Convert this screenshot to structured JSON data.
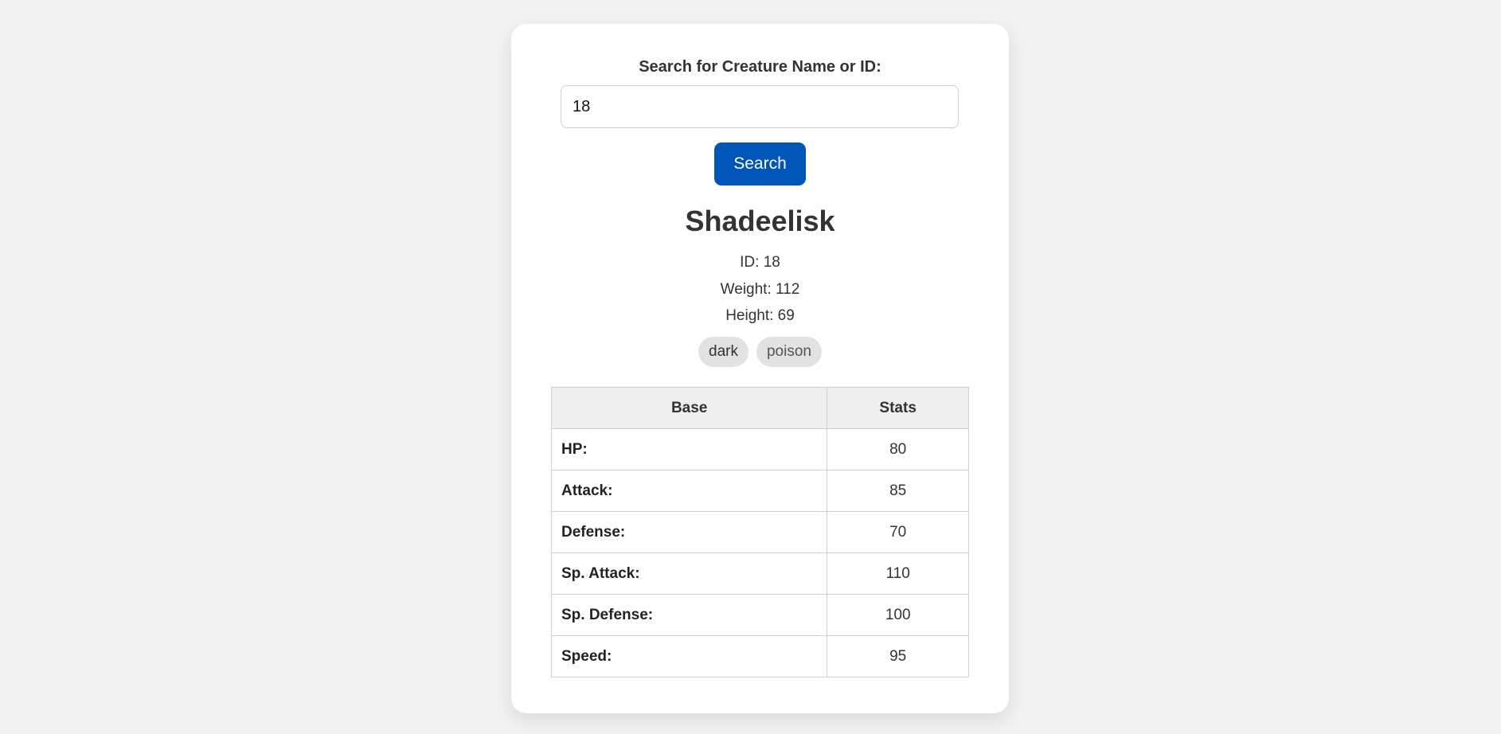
{
  "search": {
    "label": "Search for Creature Name or ID:",
    "value": "18",
    "button_label": "Search"
  },
  "creature": {
    "name": "Shadeelisk",
    "id_text": "ID: 18",
    "weight_text": "Weight: 112",
    "height_text": "Height: 69",
    "types": [
      "dark",
      "poison"
    ]
  },
  "stats_table": {
    "headers": [
      "Base",
      "Stats"
    ],
    "rows": [
      {
        "label": "HP:",
        "value": "80"
      },
      {
        "label": "Attack:",
        "value": "85"
      },
      {
        "label": "Defense:",
        "value": "70"
      },
      {
        "label": "Sp. Attack:",
        "value": "110"
      },
      {
        "label": "Sp. Defense:",
        "value": "100"
      },
      {
        "label": "Speed:",
        "value": "95"
      }
    ]
  },
  "colors": {
    "accent": "#0055b8",
    "background": "#f2f2f2",
    "badge": "#e2e2e2"
  }
}
